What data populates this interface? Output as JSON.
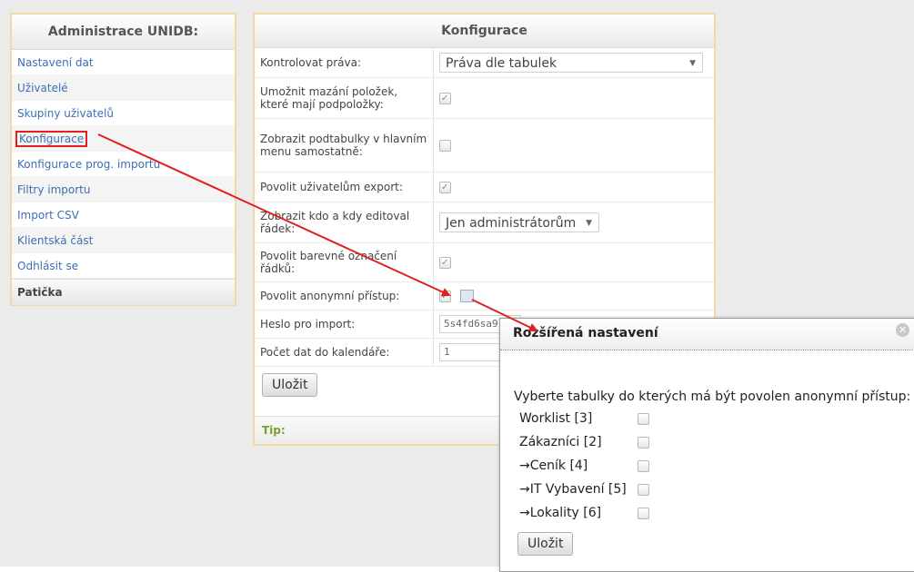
{
  "sidebar": {
    "title": "Administrace UNIDB:",
    "items": [
      {
        "label": "Nastavení dat"
      },
      {
        "label": "Uživatelé"
      },
      {
        "label": "Skupiny uživatelů"
      },
      {
        "label": "Konfigurace"
      },
      {
        "label": "Konfigurace prog. importu"
      },
      {
        "label": "Filtry importu"
      },
      {
        "label": "Import CSV"
      },
      {
        "label": "Klientská část"
      },
      {
        "label": "Odhlásit se"
      }
    ],
    "footer": "Patička"
  },
  "config": {
    "title": "Konfigurace",
    "rows": [
      {
        "label": "Kontrolovat práva:",
        "type": "select",
        "value": "Práva dle tabulek"
      },
      {
        "label": "Umožnit mazání položek, které mají podpoložky:",
        "type": "checkbox",
        "checked": true
      },
      {
        "label": "Zobrazit podtabulky v hlavním menu samostatně:",
        "type": "checkbox",
        "checked": false
      },
      {
        "label": "Povolit uživatelům export:",
        "type": "checkbox",
        "checked": true
      },
      {
        "label": "Zobrazit kdo a kdy editoval řádek:",
        "type": "select",
        "value": "Jen administrátorům"
      },
      {
        "label": "Povolit barevné označení řádků:",
        "type": "checkbox",
        "checked": true
      },
      {
        "label": "Povolit anonymní přístup:",
        "type": "checkbox",
        "checked": true
      },
      {
        "label": "Heslo pro import:",
        "type": "text",
        "value": "5s4fd6sa9"
      },
      {
        "label": "Počet dat do kalendáře:",
        "type": "text",
        "value": "1"
      }
    ],
    "save_label": "Uložit",
    "tip_label": "Tip:"
  },
  "dialog": {
    "title": "Rozšířená nastavení",
    "prompt": "Vyberte tabulky do kterých má být povolen anonymní přístup:",
    "items": [
      {
        "label": "Worklist [3]",
        "checked": false
      },
      {
        "label": "Zákazníci [2]",
        "checked": false
      },
      {
        "label": "→Ceník [4]",
        "checked": false
      },
      {
        "label": "→IT Vybavení [5]",
        "checked": false
      },
      {
        "label": "→Lokality [6]",
        "checked": false
      }
    ],
    "save_label": "Uložit"
  },
  "colors": {
    "link": "#3c6fb4",
    "panel_border": "#f3d7a6",
    "annotation": "#e02020",
    "tip": "#77a033"
  }
}
